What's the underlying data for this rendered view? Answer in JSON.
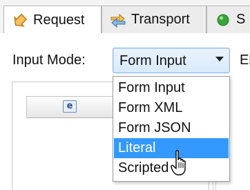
{
  "tabs": [
    {
      "label": "Request",
      "icon": "request-arrow-icon",
      "active": true
    },
    {
      "label": "Transport",
      "icon": "transport-arrows-icon",
      "active": false
    },
    {
      "label": "S",
      "icon": "status-dot-icon",
      "active": false
    }
  ],
  "input_mode": {
    "label": "Input Mode:",
    "selected": "Form Input",
    "next_label": "El"
  },
  "dropdown": {
    "options": [
      "Form Input",
      "Form XML",
      "Form JSON",
      "Literal",
      "Scripted"
    ],
    "highlighted": "Literal"
  },
  "pane": {
    "header_icon_text": "e"
  },
  "colors": {
    "selection": "#3399ff",
    "status_dot": "#3aa33a",
    "tab_icon_orange": "#f0a030"
  }
}
